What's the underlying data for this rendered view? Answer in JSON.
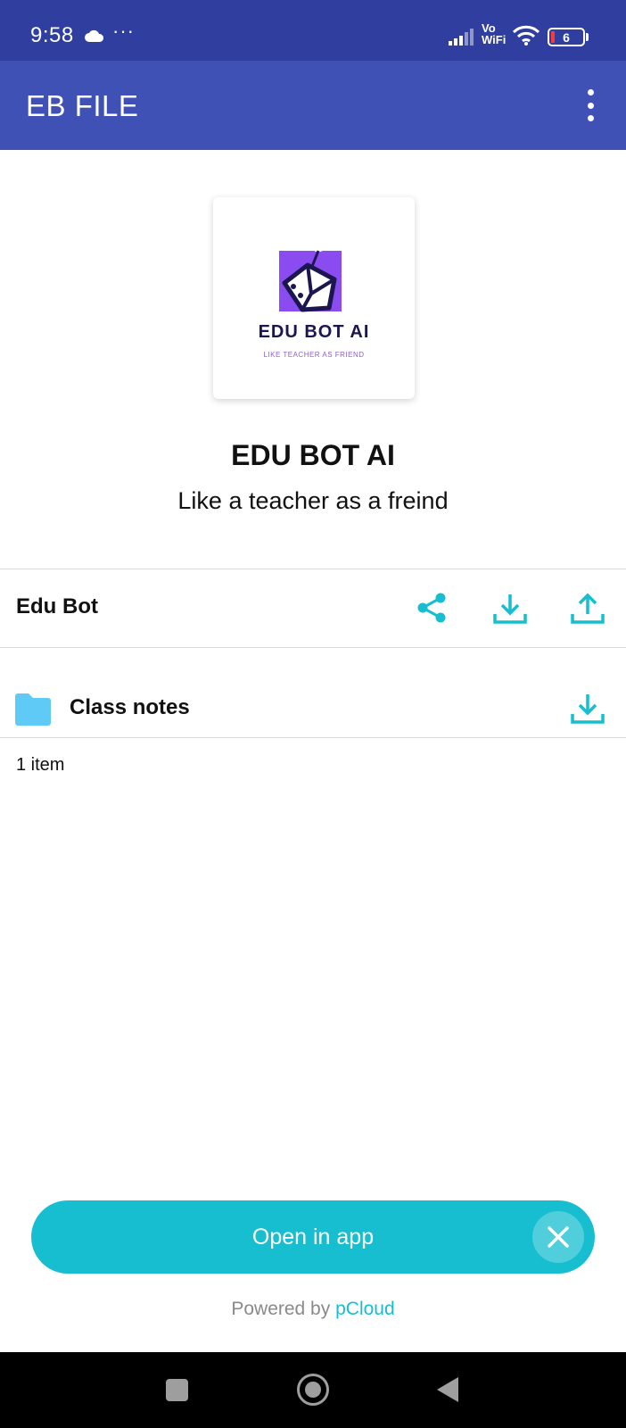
{
  "status_bar": {
    "time": "9:58",
    "dots": "···",
    "network_label": "Vo\nWiFi",
    "battery_level": "6",
    "icons": [
      "cloud-icon",
      "signal-icon",
      "wifi-icon",
      "battery-icon"
    ]
  },
  "app_bar": {
    "title": "EB FILE",
    "menu_icon": "more-vert-icon"
  },
  "logo": {
    "name": "EDU BOT AI",
    "tagline": "LIKE TEACHER AS FRIEND"
  },
  "hero": {
    "title": "EDU BOT AI",
    "subtitle": "Like a teacher as a freind"
  },
  "folder_header": {
    "title": "Edu Bot",
    "actions": [
      "share-icon",
      "download-icon",
      "upload-icon"
    ]
  },
  "files": [
    {
      "name": "Class notes",
      "type": "folder",
      "action": "download-icon"
    }
  ],
  "item_count": "1 item",
  "banner": {
    "label": "Open in app",
    "close_icon": "close-icon"
  },
  "footer": {
    "powered_prefix": "Powered by",
    "brand": "pCloud"
  },
  "colors": {
    "status_bar": "#303f9f",
    "app_bar": "#3f51b5",
    "accent": "#17bed0",
    "folder": "#5ecaf5"
  }
}
